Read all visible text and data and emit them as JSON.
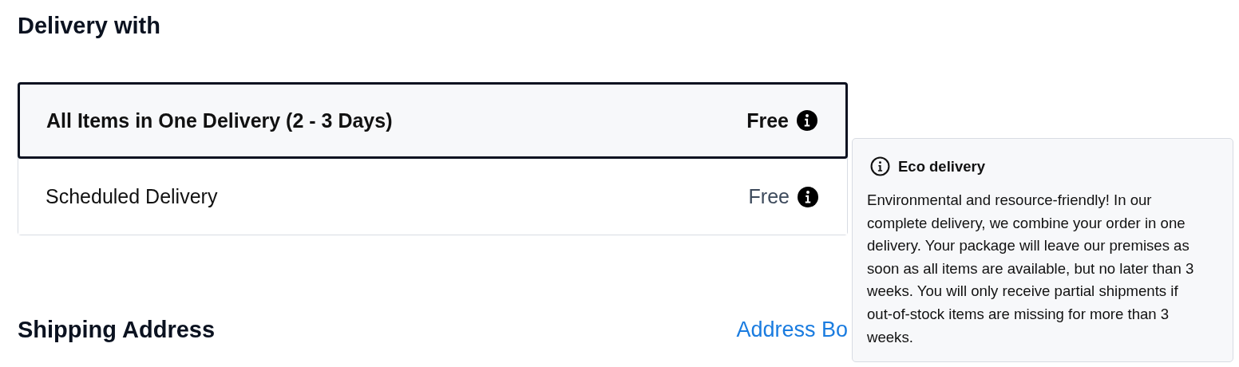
{
  "delivery_heading": "Delivery with",
  "options": [
    {
      "label": "All Items in One Delivery (2 - 3 Days)",
      "price": "Free",
      "selected": true
    },
    {
      "label": "Scheduled Delivery",
      "price": "Free",
      "selected": false
    }
  ],
  "tooltip": {
    "title": "Eco delivery",
    "text": "Environmental and resource-friendly! In our complete delivery, we combine your order in one delivery. Your package will leave our premises as soon as all items are available, but no later than 3 weeks. You will only receive partial shipments if out-of-stock items are missing for more than 3 weeks."
  },
  "shipping_heading": "Shipping Address",
  "address_link": "Address Bo"
}
